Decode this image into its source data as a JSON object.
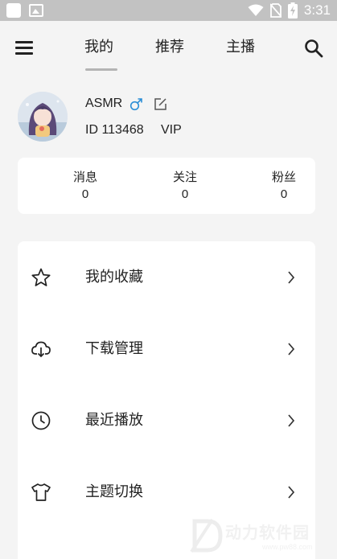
{
  "status_bar": {
    "time": "3:31",
    "icons": [
      "app-icon",
      "image-icon",
      "wifi-icon",
      "no-sim-icon",
      "battery-charging-icon"
    ]
  },
  "nav": {
    "tabs": [
      {
        "label": "我的",
        "active": true
      },
      {
        "label": "推荐",
        "active": false
      },
      {
        "label": "主播",
        "active": false
      }
    ],
    "icons": [
      "menu-icon",
      "search-icon"
    ]
  },
  "profile": {
    "username": "ASMR",
    "gender": "male",
    "id_text": "ID 113468",
    "vip": "VIP"
  },
  "stats": [
    {
      "label": "消息",
      "value": "0"
    },
    {
      "label": "关注",
      "value": "0"
    },
    {
      "label": "粉丝",
      "value": "0"
    }
  ],
  "menu": [
    {
      "label": "我的收藏",
      "icon": "star-icon"
    },
    {
      "label": "下载管理",
      "icon": "cloud-download-icon"
    },
    {
      "label": "最近播放",
      "icon": "clock-icon"
    },
    {
      "label": "主题切换",
      "icon": "tshirt-icon"
    }
  ],
  "watermark": {
    "text": "动力软件园",
    "sub": "www.pw88.com"
  },
  "colors": {
    "status_bar": "#c2c2c2",
    "background": "#f4f4f4",
    "card": "#ffffff",
    "tab_indicator": "#b4b4b4",
    "gender_male": "#2b8ed6"
  }
}
